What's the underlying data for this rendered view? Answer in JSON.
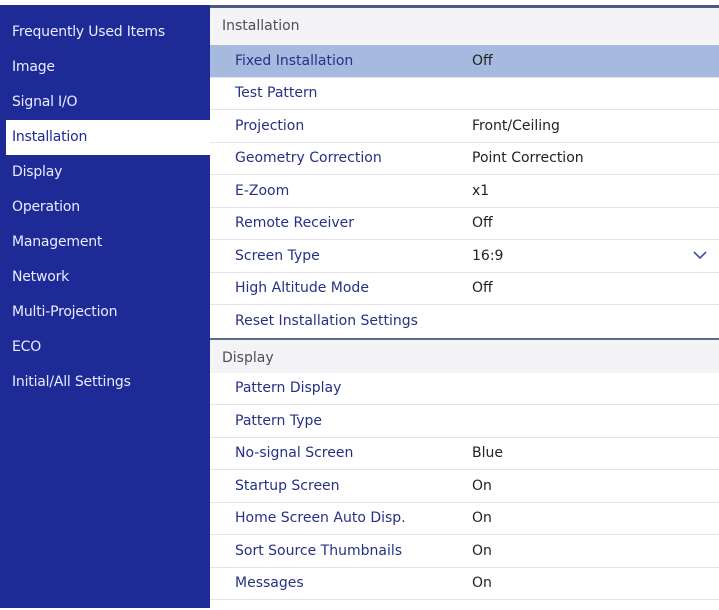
{
  "sidebar": {
    "items": [
      {
        "label": "Frequently Used Items"
      },
      {
        "label": "Image"
      },
      {
        "label": "Signal I/O"
      },
      {
        "label": "Installation"
      },
      {
        "label": "Display"
      },
      {
        "label": "Operation"
      },
      {
        "label": "Management"
      },
      {
        "label": "Network"
      },
      {
        "label": "Multi-Projection"
      },
      {
        "label": "ECO"
      },
      {
        "label": "Initial/All Settings"
      }
    ],
    "selected": "Installation"
  },
  "installation": {
    "header": "Installation",
    "rows": [
      {
        "label": "Fixed Installation",
        "value": "Off"
      },
      {
        "label": "Test Pattern",
        "value": ""
      },
      {
        "label": "Projection",
        "value": "Front/Ceiling"
      },
      {
        "label": "Geometry Correction",
        "value": "Point Correction"
      },
      {
        "label": "E-Zoom",
        "value": "x1"
      },
      {
        "label": "Remote Receiver",
        "value": "Off"
      },
      {
        "label": "Screen Type",
        "value": "16:9"
      },
      {
        "label": "High Altitude Mode",
        "value": "Off"
      },
      {
        "label": "Reset Installation Settings",
        "value": ""
      }
    ]
  },
  "display": {
    "header": "Display",
    "rows": [
      {
        "label": "Pattern Display",
        "value": ""
      },
      {
        "label": "Pattern Type",
        "value": ""
      },
      {
        "label": "No-signal Screen",
        "value": "Blue"
      },
      {
        "label": "Startup Screen",
        "value": "On"
      },
      {
        "label": "Home Screen Auto Disp.",
        "value": "On"
      },
      {
        "label": "Sort Source Thumbnails",
        "value": "On"
      },
      {
        "label": "Messages",
        "value": "On"
      }
    ]
  },
  "colors": {
    "sidebar_bg": "#1e2a96",
    "highlight_row": "#a6b9de",
    "label_text": "#253186"
  }
}
